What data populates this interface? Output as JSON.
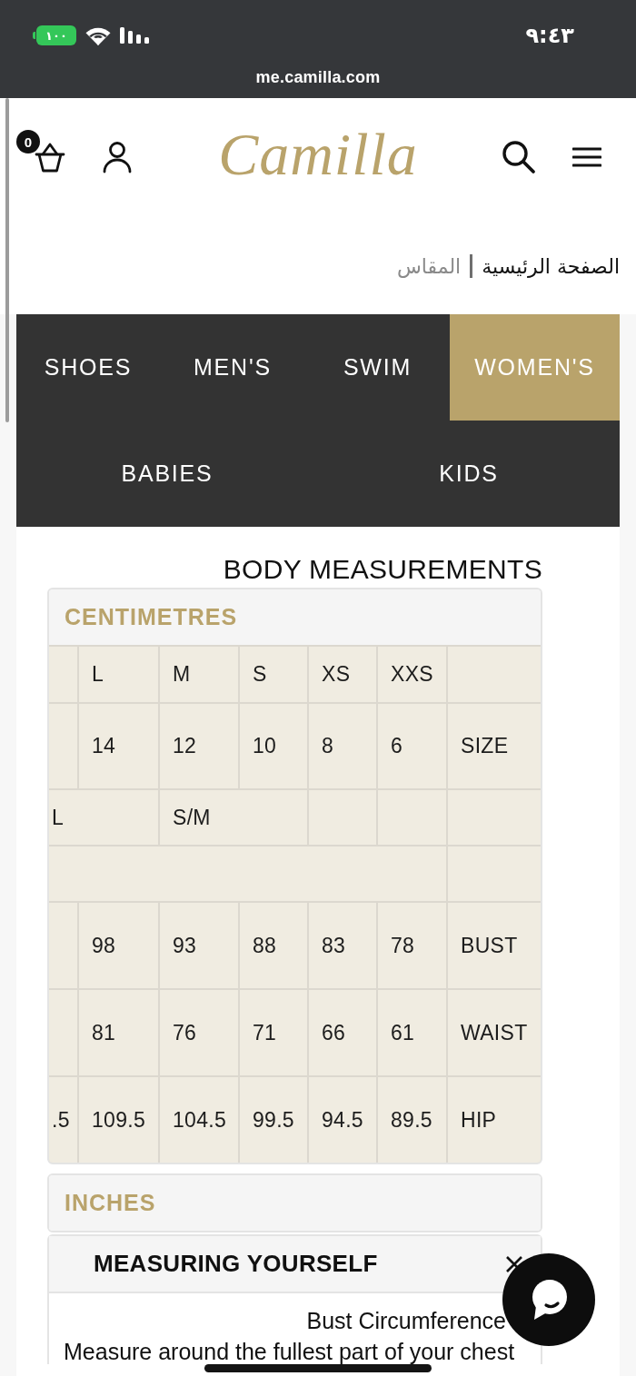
{
  "status_bar": {
    "battery": "١٠٠",
    "time": "٩:٤٣",
    "url": "me.camilla.com"
  },
  "header": {
    "cart_count": "0",
    "logo": "Camilla"
  },
  "breadcrumb": [
    {
      "label": "الصفحة الرئيسية",
      "current": false
    },
    {
      "label": "المقاس",
      "current": true
    }
  ],
  "tab_rows": [
    [
      {
        "label": "SHOES",
        "selected": false
      },
      {
        "label": "MEN'S",
        "selected": false
      },
      {
        "label": "SWIM",
        "selected": false
      },
      {
        "label": "WOMEN'S",
        "selected": true
      }
    ],
    [
      {
        "label": "BABIES",
        "selected": false
      },
      {
        "label": "KIDS",
        "selected": false
      }
    ]
  ],
  "title": "BODY MEASUREMENTS",
  "sections": [
    {
      "title": "CENTIMETRES",
      "expanded": true,
      "table": {
        "rows": [
          {
            "cells": [
              {
                "kind": "single"
              },
              {
                "kind": "single",
                "text": "L"
              },
              {
                "kind": "single",
                "text": "M"
              },
              {
                "kind": "single",
                "text": "S"
              },
              {
                "kind": "single",
                "text": "XS"
              },
              {
                "kind": "single",
                "text": "XXS"
              },
              {
                "kind": "single"
              }
            ]
          },
          {
            "cells": [
              {
                "kind": "single"
              },
              {
                "kind": "single",
                "text": "14"
              },
              {
                "kind": "single",
                "text": "12"
              },
              {
                "kind": "single",
                "text": "10"
              },
              {
                "kind": "single",
                "text": "8"
              },
              {
                "kind": "single",
                "text": "6"
              },
              {
                "kind": "single",
                "text": "SIZE"
              }
            ]
          },
          {
            "cells": [
              {
                "kind": "double",
                "text": "L"
              },
              {
                "kind": "covered"
              },
              {
                "kind": "double",
                "text": "S/M"
              },
              {
                "kind": "covered"
              },
              {
                "kind": "single"
              },
              {
                "kind": "single"
              },
              {
                "kind": "single"
              }
            ]
          },
          {
            "cells": [
              {
                "kind": "full"
              },
              {
                "kind": "covered"
              },
              {
                "kind": "covered"
              },
              {
                "kind": "covered"
              },
              {
                "kind": "covered"
              },
              {
                "kind": "covered"
              },
              {
                "kind": "single"
              }
            ]
          },
          {
            "cells": [
              {
                "kind": "single"
              },
              {
                "kind": "single",
                "text": "98"
              },
              {
                "kind": "single",
                "text": "93"
              },
              {
                "kind": "single",
                "text": "88"
              },
              {
                "kind": "single",
                "text": "83"
              },
              {
                "kind": "single",
                "text": "78"
              },
              {
                "kind": "single",
                "text": "BUST"
              }
            ]
          },
          {
            "cells": [
              {
                "kind": "single"
              },
              {
                "kind": "single",
                "text": "81"
              },
              {
                "kind": "single",
                "text": "76"
              },
              {
                "kind": "single",
                "text": "71"
              },
              {
                "kind": "single",
                "text": "66"
              },
              {
                "kind": "single",
                "text": "61"
              },
              {
                "kind": "single",
                "text": "WAIST"
              }
            ]
          },
          {
            "cells": [
              {
                "kind": "single",
                "text": ".5"
              },
              {
                "kind": "single",
                "text": "109.5"
              },
              {
                "kind": "single",
                "text": "104.5"
              },
              {
                "kind": "single",
                "text": "99.5"
              },
              {
                "kind": "single",
                "text": "94.5"
              },
              {
                "kind": "single",
                "text": "89.5"
              },
              {
                "kind": "single",
                "text": "HIP"
              }
            ]
          }
        ]
      }
    },
    {
      "title": "INCHES",
      "expanded": false
    }
  ],
  "measuring": {
    "title": "MEASURING YOURSELF",
    "expanded": true,
    "items": [
      {
        "heading": "Bust Circumference",
        "text": "Measure around the fullest part of your chest"
      }
    ]
  }
}
